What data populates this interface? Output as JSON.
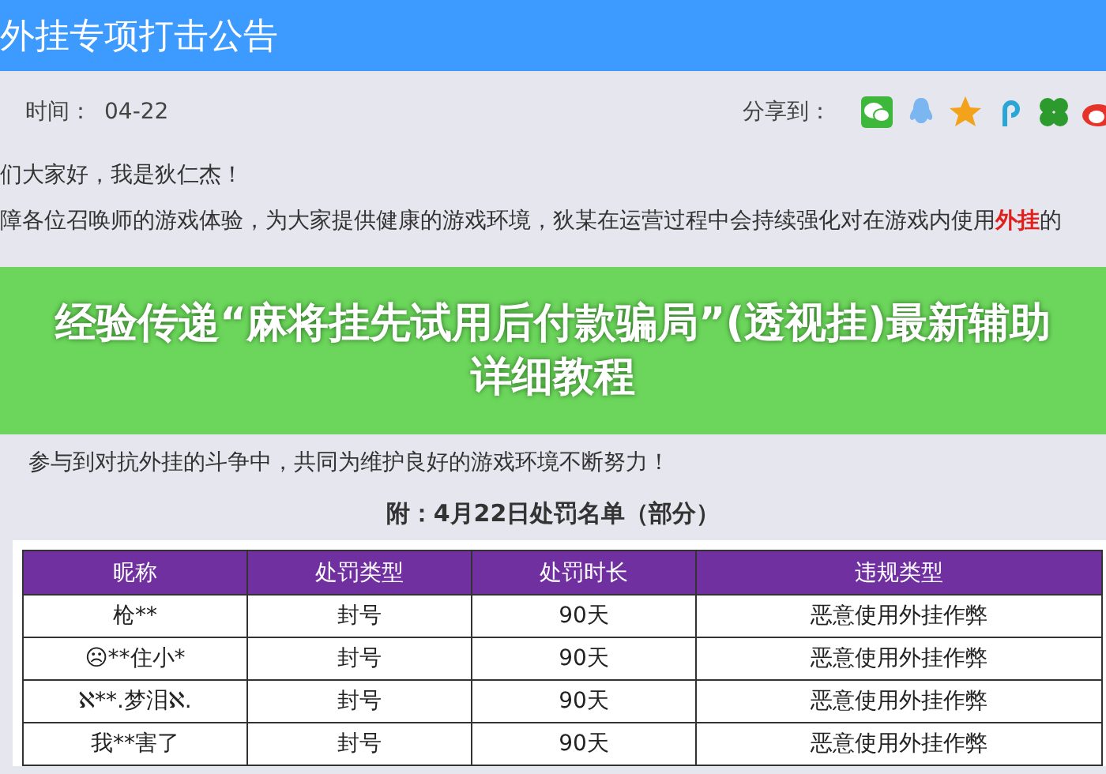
{
  "header": {
    "title": "外挂专项打击公告"
  },
  "meta": {
    "time_label": "时间：",
    "time": "04-22",
    "share_label": "分享到："
  },
  "paragraphs": [
    "们大家好，我是狄仁杰！",
    "障各位召唤师的游戏体验，为大家提供健康的游戏环境，狄某在运营过程中会持续强化对在游戏内使用**外挂**的"
  ],
  "banner": {
    "title": "经验传递“麻将挂先试用后付款骗局”(透视挂)最新辅助详细教程"
  },
  "closing": "参与到对抗外挂的斗争中，共同为维护良好的游戏环境不断努力！",
  "table": {
    "caption": "附：4月22日处罚名单（部分）",
    "columns": [
      "昵称",
      "处罚类型",
      "处罚时长",
      "违规类型"
    ],
    "rows": [
      [
        "枪**",
        "封号",
        "90天",
        "恶意使用外挂作弊"
      ],
      [
        "☹**住小*",
        "封号",
        "90天",
        "恶意使用外挂作弊"
      ],
      [
        "ℵ**.梦泪ℵ.",
        "封号",
        "90天",
        "恶意使用外挂作弊"
      ],
      [
        "我**害了",
        "封号",
        "90天",
        "恶意使用外挂作弊"
      ]
    ]
  }
}
